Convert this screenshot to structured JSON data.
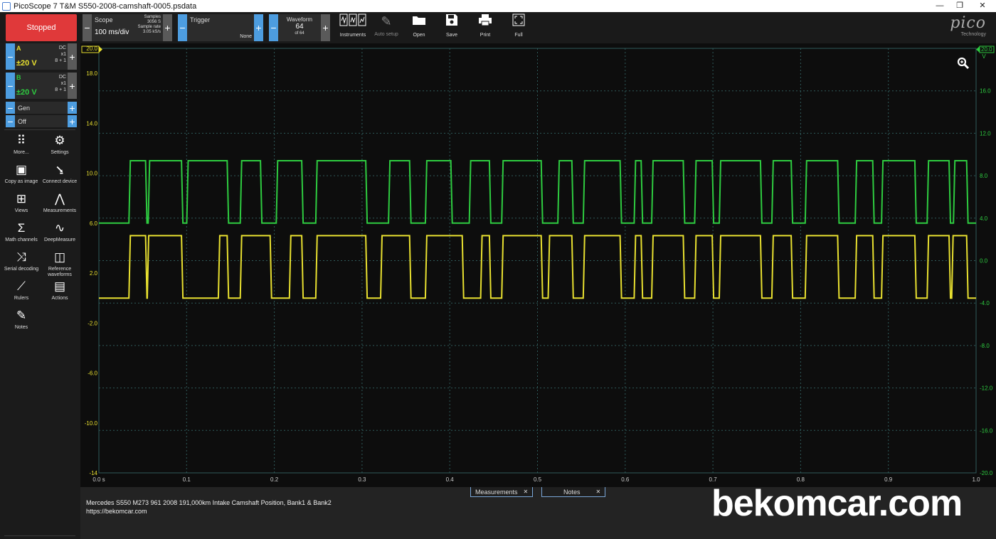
{
  "window": {
    "title": "PicoScope 7 T&M S550-2008-camshaft-0005.psdata",
    "minimize": "—",
    "restore": "❐",
    "close": "✕"
  },
  "toolbar": {
    "stop_label": "Stopped",
    "scope": {
      "label": "Scope",
      "timebase": "100 ms/div",
      "samples_label": "Samples",
      "samples_value": "3056 S",
      "rate_label": "Sample rate",
      "rate_value": "3.05 kS/s"
    },
    "trigger": {
      "label": "Trigger",
      "mode": "None"
    },
    "waveform": {
      "label": "Waveform",
      "index": "64",
      "of": "of 64"
    },
    "buttons": [
      {
        "label": "Instruments",
        "icon": "instruments-icon"
      },
      {
        "label": "Auto setup",
        "icon": "wand-icon",
        "disabled": true
      },
      {
        "label": "Open",
        "icon": "folder-icon"
      },
      {
        "label": "Save",
        "icon": "save-icon"
      },
      {
        "label": "Print",
        "icon": "print-icon"
      },
      {
        "label": "Full",
        "icon": "fullscreen-icon"
      }
    ],
    "logo_name": "pico",
    "logo_sub": "Technology"
  },
  "channels": [
    {
      "name": "A",
      "range": "±20 V",
      "coupling": "DC",
      "probe": "x1",
      "bits": "8 + 1",
      "color": "#e8e030"
    },
    {
      "name": "B",
      "range": "±20 V",
      "coupling": "DC",
      "probe": "x1",
      "bits": "8 + 1",
      "color": "#2ecc40"
    }
  ],
  "generator": {
    "label": "Gen",
    "state": "Off"
  },
  "side_tools": [
    {
      "label": "More...",
      "icon": "grid-icon"
    },
    {
      "label": "Settings",
      "icon": "gear-icon"
    },
    {
      "label": "Copy as image",
      "icon": "image-icon"
    },
    {
      "label": "Connect device",
      "icon": "usb-icon"
    },
    {
      "label": "Views",
      "icon": "views-icon"
    },
    {
      "label": "Measurements",
      "icon": "compass-icon"
    },
    {
      "label": "Math channels",
      "icon": "sigma-icon"
    },
    {
      "label": "DeepMeasure",
      "icon": "deepmeasure-icon"
    },
    {
      "label": "Serial decoding",
      "icon": "serial-icon"
    },
    {
      "label": "Reference waveforms",
      "icon": "reference-icon"
    },
    {
      "label": "Rulers",
      "icon": "ruler-icon"
    },
    {
      "label": "Actions",
      "icon": "clapper-icon"
    },
    {
      "label": "Notes",
      "icon": "notes-icon"
    }
  ],
  "colors": {
    "channel_a": "#e8e030",
    "channel_b": "#2ecc40",
    "grid": "#2f5a5a",
    "stop": "#e0393a",
    "accent": "#4d9de0"
  },
  "bottom": {
    "tabs": [
      {
        "label": "Measurements"
      },
      {
        "label": "Notes"
      }
    ],
    "note_line1": "Mercedes S550 M273 961 2008 191,000km Intake Camshaft Position, Bank1 & Bank2",
    "note_line2": "https://bekomcar.com",
    "watermark": "bekomcar.com"
  },
  "chart_data": {
    "type": "line",
    "xlabel": "",
    "x_ticks": [
      "0.0 s",
      "0.1",
      "0.2",
      "0.3",
      "0.4",
      "0.5",
      "0.6",
      "0.7",
      "0.8",
      "0.9",
      "1.0"
    ],
    "xlim": [
      0,
      1.0
    ],
    "left_axis": {
      "unit": "V",
      "ylim": [
        -14,
        20
      ],
      "ticks": [
        "20.0",
        "18.0",
        "14.0",
        "10.0",
        "6.0",
        "2.0",
        "-2.0",
        "-6.0",
        "-10.0",
        "-14"
      ]
    },
    "right_axis": {
      "unit": "V",
      "ylim": [
        -20,
        20
      ],
      "ticks": [
        "20.0",
        "16.0",
        "12.0",
        "8.0",
        "4.0",
        "0.0",
        "-4.0",
        "-8.0",
        "-12.0",
        "-16.0",
        "-20.0"
      ]
    },
    "grid": true,
    "series": [
      {
        "color": "#e8e030",
        "low": 0.0,
        "high": 5.0,
        "high_intervals": [
          [
            0.035,
            0.054
          ],
          [
            0.056,
            0.095
          ],
          [
            0.137,
            0.147
          ],
          [
            0.162,
            0.196
          ],
          [
            0.218,
            0.232
          ],
          [
            0.248,
            0.305
          ],
          [
            0.322,
            0.355
          ],
          [
            0.373,
            0.415
          ],
          [
            0.436,
            0.446
          ],
          [
            0.46,
            0.505
          ],
          [
            0.513,
            0.54
          ],
          [
            0.553,
            0.595
          ],
          [
            0.611,
            0.619
          ],
          [
            0.631,
            0.667
          ],
          [
            0.68,
            0.7
          ],
          [
            0.708,
            0.755
          ],
          [
            0.768,
            0.79
          ],
          [
            0.806,
            0.843
          ],
          [
            0.863,
            0.883
          ],
          [
            0.893,
            0.931
          ],
          [
            0.945,
            0.97
          ],
          [
            0.973,
            0.99
          ]
        ]
      },
      {
        "color": "#2ecc40",
        "low": 6.0,
        "high": 11.0,
        "high_intervals": [
          [
            0.035,
            0.054
          ],
          [
            0.057,
            0.095
          ],
          [
            0.101,
            0.147
          ],
          [
            0.162,
            0.185
          ],
          [
            0.203,
            0.232
          ],
          [
            0.248,
            0.305
          ],
          [
            0.331,
            0.355
          ],
          [
            0.373,
            0.402
          ],
          [
            0.423,
            0.446
          ],
          [
            0.46,
            0.505
          ],
          [
            0.524,
            0.54
          ],
          [
            0.553,
            0.595
          ],
          [
            0.611,
            0.619
          ],
          [
            0.631,
            0.667
          ],
          [
            0.68,
            0.7
          ],
          [
            0.708,
            0.755
          ],
          [
            0.768,
            0.79
          ],
          [
            0.806,
            0.843
          ],
          [
            0.863,
            0.883
          ],
          [
            0.893,
            0.931
          ],
          [
            0.945,
            0.97
          ],
          [
            0.975,
            0.99
          ]
        ]
      }
    ]
  }
}
